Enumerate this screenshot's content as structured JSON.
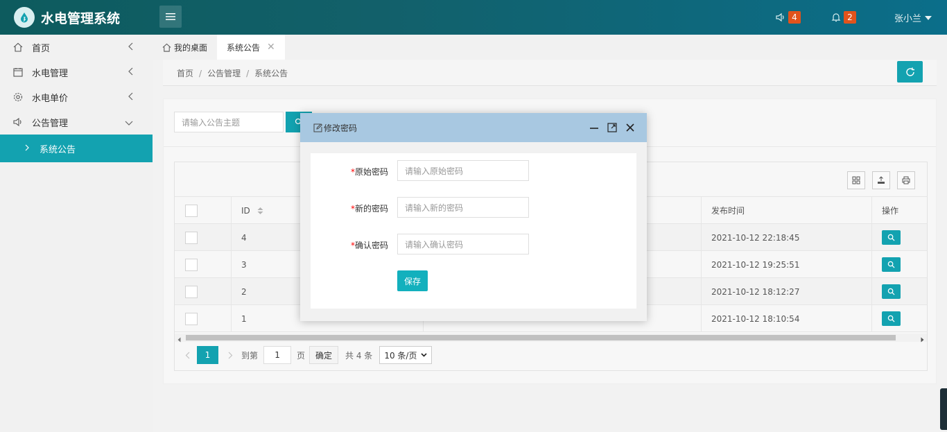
{
  "app": {
    "title": "水电管理系统"
  },
  "header": {
    "announce_count": "4",
    "bell_count": "2",
    "user_name": "张小兰"
  },
  "sidebar": {
    "items": [
      {
        "label": "首页",
        "icon": "home-icon"
      },
      {
        "label": "水电管理",
        "icon": "calendar-icon"
      },
      {
        "label": "水电单价",
        "icon": "gear-icon"
      },
      {
        "label": "公告管理",
        "icon": "speaker-icon"
      }
    ],
    "sub_active": "系统公告"
  },
  "tabs": [
    {
      "label": "我的桌面"
    },
    {
      "label": "系统公告"
    }
  ],
  "breadcrumb": [
    "首页",
    "公告管理",
    "系统公告"
  ],
  "search": {
    "placeholder": "请输入公告主题"
  },
  "table": {
    "columns": {
      "id": "ID",
      "time": "发布时间",
      "action": "操作"
    },
    "rows": [
      {
        "id": "4",
        "time": "2021-10-12 22:18:45"
      },
      {
        "id": "3",
        "time": "2021-10-12 19:25:51"
      },
      {
        "id": "2",
        "time": "2021-10-12 18:12:27"
      },
      {
        "id": "1",
        "time": "2021-10-12 18:10:54"
      }
    ]
  },
  "pager": {
    "current": "1",
    "goto_label": "到第",
    "goto_value": "1",
    "page_suffix": "页",
    "confirm": "确定",
    "total": "共 4 条",
    "page_size": "10 条/页"
  },
  "dialog": {
    "title": "修改密码",
    "fields": [
      {
        "label": "原始密码",
        "placeholder": "请输入原始密码"
      },
      {
        "label": "新的密码",
        "placeholder": "请输入新的密码"
      },
      {
        "label": "确认密码",
        "placeholder": "请输入确认密码"
      }
    ],
    "save": "保存",
    "required_mark": "*"
  },
  "colors": {
    "accent": "#13a2b0",
    "badge": "#e1531c",
    "dialog_header": "#a8c8e1"
  }
}
